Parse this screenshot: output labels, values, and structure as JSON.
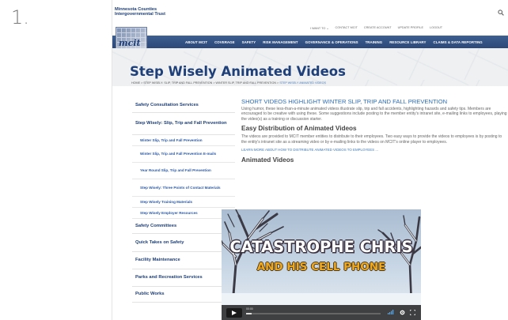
{
  "list_number": "1.",
  "brand": {
    "line1": "Minnesota Counties",
    "line2": "Intergovernmental Trust",
    "logo_text": "mcit"
  },
  "util_nav": [
    "I WANT TO ⌄",
    "CONTACT MCIT",
    "CREATE ACCOUNT",
    "UPDATE PROFILE",
    "LOGOUT"
  ],
  "main_nav": [
    "ABOUT MCIT",
    "COVERAGE",
    "SAFETY",
    "RISK MANAGEMENT",
    "GOVERNANCE & OPERATIONS",
    "TRAINING",
    "RESOURCE LIBRARY",
    "CLAIMS & DATA REPORTING"
  ],
  "page_title": "Step Wisely Animated Videos",
  "breadcrumb": {
    "path": "HOME > STEP WISELY: SLIP, TRIP AND FALL PREVENTION > WINTER SLIP, TRIP AND FALL PREVENTION > ",
    "current": "STEP WISELY ANIMATED VIDEOS"
  },
  "sidebar": [
    {
      "label": "Safety Consultation Services",
      "level": 1
    },
    {
      "label": "Step Wisely: Slip, Trip and Fall Prevention",
      "level": 1
    },
    {
      "label": "Winter Slip, Trip and Fall Prevention",
      "level": 2
    },
    {
      "label": "Winter Slip, Trip and Fall Prevention E-mails",
      "level": 2
    },
    {
      "label": "Year Round Slip, Trip and Fall Prevention",
      "level": 2
    },
    {
      "label": "Step Wisely: Three Points of Contact Materials",
      "level": 2
    },
    {
      "label": "Step Wisely Training Materials",
      "level": 2
    },
    {
      "label": "Step Wisely Employer Resources",
      "level": 2
    },
    {
      "label": "Safety Committees",
      "level": 1
    },
    {
      "label": "Quick Takes on Safety",
      "level": 1
    },
    {
      "label": "Facility Maintenance",
      "level": 1
    },
    {
      "label": "Parks and Recreation Services",
      "level": 1
    },
    {
      "label": "Public Works",
      "level": 1
    }
  ],
  "content": {
    "heading1": "SHORT VIDEOS HIGHLIGHT WINTER SLIP, TRIP AND FALL PREVENTION",
    "para1": "Using humor, these less-than-a-minute animated videos illustrate slip, trip and fall accidents, highlighting hazards and safety tips. Members are encouraged to be creative with using these. Some suggestions include posting to the member entity's intranet site, e-mailing links to employees, playing the video(s) as a training or discussion starter.",
    "heading2": "Easy Distribution of Animated Videos",
    "para2": "The videos are provided to MCIT member entities to distribute to their employees. Two easy ways to provide the videos to employees is by posting to the entity's intranet site as a streaming video or by e-mailing links to the videos on MCIT's online player to employees.",
    "link": "LEARN MORE ABOUT HOW TO DISTRIBUTE ANIMATED VIDEOS TO EMPLOYEES ...",
    "heading3": "Animated Videos"
  },
  "video": {
    "title_line1": "CATASTROPHE CHRIS",
    "title_line2": "AND HIS CELL PHONE",
    "time": "00:00",
    "progress": 0.04
  },
  "colors": {
    "brand_navy": "#1e3f78",
    "nav_bar": "#2b4878",
    "link_blue": "#2d6cb5",
    "video_subtitle": "#f0a81f"
  },
  "icons": [
    "search-icon",
    "play-icon",
    "volume-icon",
    "settings-icon",
    "fullscreen-icon"
  ]
}
